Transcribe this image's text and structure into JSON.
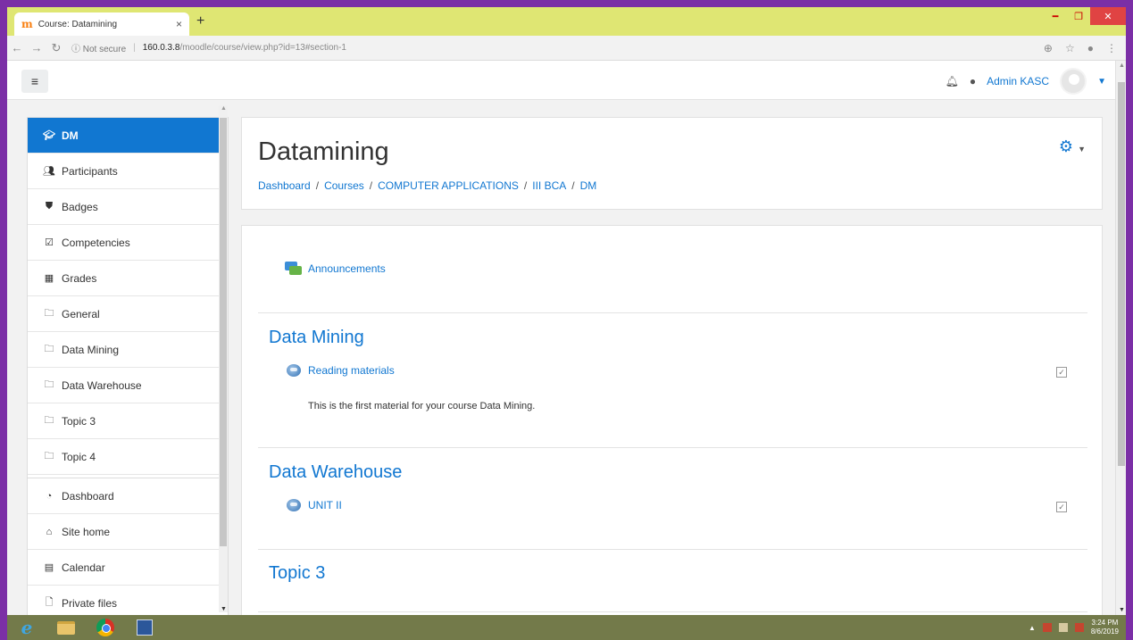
{
  "browser": {
    "tab_favicon": "m",
    "tab_title": "Course: Datamining",
    "tab_close": "×",
    "new_tab": "+",
    "secure_label": "ⓘ Not secure",
    "url_host": "160.0.3.8",
    "url_path": "/moodle/course/view.php?id=13#section-1"
  },
  "navbar": {
    "user_name": "Admin KASC"
  },
  "drawer": {
    "items": [
      {
        "label": "DM",
        "icon": "graduation-cap-icon"
      },
      {
        "label": "Participants",
        "icon": "users-icon"
      },
      {
        "label": "Badges",
        "icon": "shield-icon"
      },
      {
        "label": "Competencies",
        "icon": "checkbox-icon"
      },
      {
        "label": "Grades",
        "icon": "table-icon"
      },
      {
        "label": "General",
        "icon": "folder-icon"
      },
      {
        "label": "Data Mining",
        "icon": "folder-icon"
      },
      {
        "label": "Data Warehouse",
        "icon": "folder-icon"
      },
      {
        "label": "Topic 3",
        "icon": "folder-icon"
      },
      {
        "label": "Topic 4",
        "icon": "folder-icon"
      }
    ],
    "items2": [
      {
        "label": "Dashboard",
        "icon": "dashboard-icon"
      },
      {
        "label": "Site home",
        "icon": "home-icon"
      },
      {
        "label": "Calendar",
        "icon": "calendar-icon"
      },
      {
        "label": "Private files",
        "icon": "file-icon"
      }
    ]
  },
  "header": {
    "title": "Datamining",
    "breadcrumb": [
      "Dashboard",
      "Courses",
      "COMPUTER APPLICATIONS",
      "III BCA",
      "DM"
    ]
  },
  "content": {
    "announcements": "Announcements",
    "sections": [
      {
        "title": "Data Mining",
        "activity": "Reading materials",
        "description": "This is the first material for your course Data Mining."
      },
      {
        "title": "Data Warehouse",
        "activity": "UNIT II"
      },
      {
        "title": "Topic 3"
      }
    ]
  },
  "taskbar": {
    "time": "3:24 PM",
    "date": "8/6/2019"
  },
  "colors": {
    "accent": "#1177d1",
    "tabstrip": "#dfe673",
    "taskbar": "#737a4a",
    "frame": "#7b2fa6"
  }
}
